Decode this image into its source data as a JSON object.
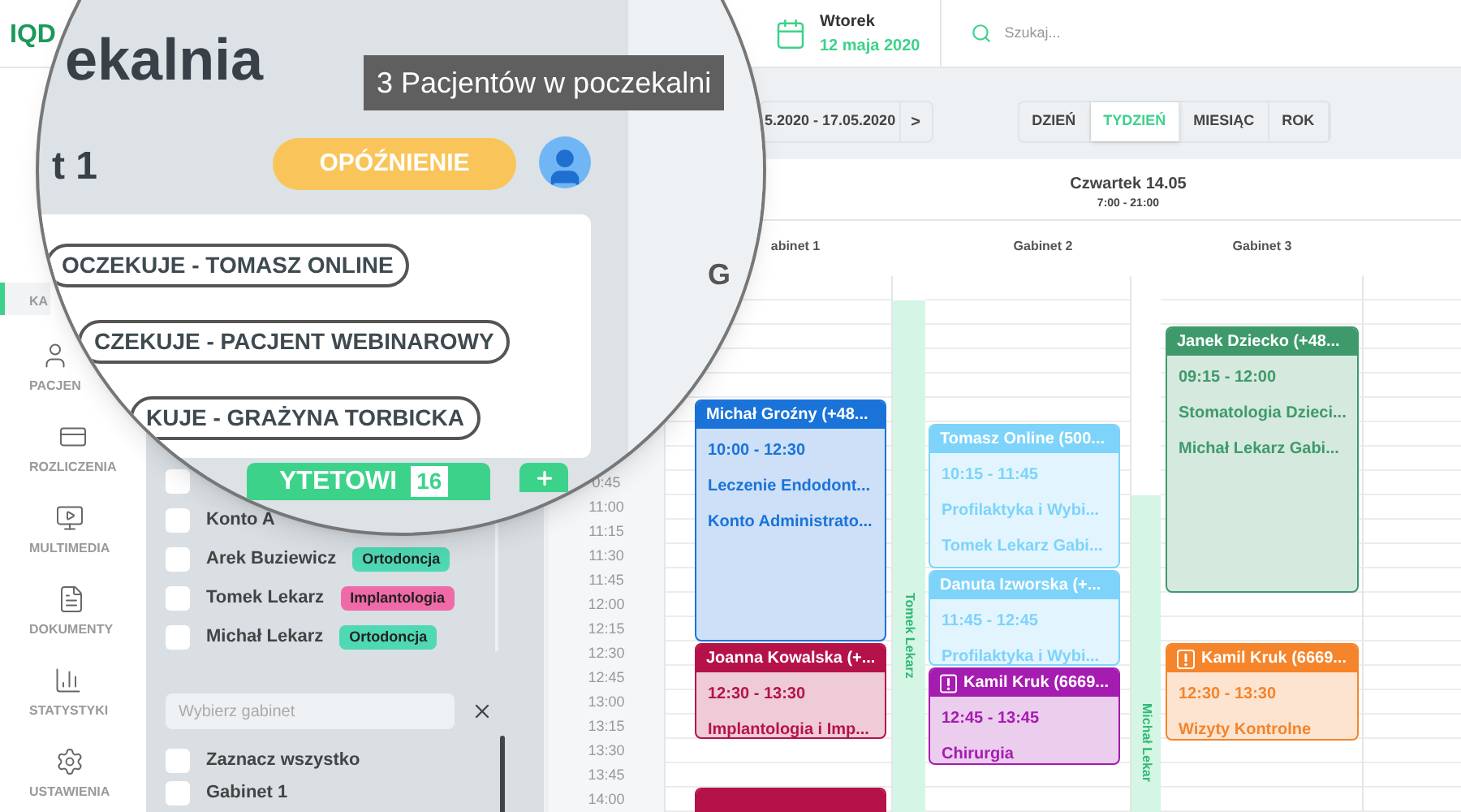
{
  "logo": "IQD",
  "sidebar": {
    "items": [
      {
        "label": "KA",
        "selected": true
      },
      {
        "label": "PACJEN",
        "selected": false
      },
      {
        "label": "ROZLICZENIA",
        "selected": false
      },
      {
        "label": "MULTIMEDIA",
        "selected": false
      },
      {
        "label": "DOKUMENTY",
        "selected": false
      },
      {
        "label": "STATYSTYKI",
        "selected": false
      },
      {
        "label": "USTAWIENIA",
        "selected": false
      }
    ]
  },
  "magnifier": {
    "title": "ekalnia",
    "tooltip": "3 Pacjentów w poczekalni",
    "subtitle": "t 1",
    "delay_button": "OPÓŹNIENIE",
    "waiting": [
      "OCZEKUJE - TOMASZ ONLINE",
      "CZEKUJE - PACJENT WEBINAROWY",
      "KUJE - GRAŻYNA TORBICKA"
    ],
    "green_button": {
      "label": "YTETOWI",
      "count": "16"
    },
    "column_heading": "G"
  },
  "doctors": [
    {
      "checked": false
    },
    {
      "name": "Konto A",
      "checked": false
    },
    {
      "name": "Arek Buziewicz",
      "checked": false,
      "tag": {
        "label": "Ortodoncja",
        "color": "#4fd8b4"
      }
    },
    {
      "name": "Tomek Lekarz",
      "checked": false,
      "tag": {
        "label": "Implantologia",
        "color": "#f06aa8"
      }
    },
    {
      "name": "Michał Lekarz",
      "checked": false,
      "tag": {
        "label": "Ortodoncja",
        "color": "#4fd8b4"
      }
    }
  ],
  "room_filter": {
    "placeholder": "Wybierz gabinet"
  },
  "rooms": [
    {
      "label": "Zaznacz wszystko",
      "checked": false
    },
    {
      "label": "Gabinet 1",
      "checked": false
    }
  ],
  "topbar": {
    "day": "Wtorek",
    "date": "12 maja 2020",
    "search_placeholder": "Szukaj..."
  },
  "date_range": {
    "label": "5.2020 - 17.05.2020",
    "next": ">"
  },
  "view_tabs": [
    {
      "label": "DZIEŃ",
      "selected": false
    },
    {
      "label": "TYDZIEŃ",
      "selected": true
    },
    {
      "label": "MIESIĄC",
      "selected": false
    },
    {
      "label": "ROK",
      "selected": false
    }
  ],
  "calendar": {
    "day": "Czwartek 14.05",
    "hours": "7:00 - 21:00",
    "times": [
      "0:45",
      "11:00",
      "11:15",
      "11:30",
      "11:45",
      "12:00",
      "12:15",
      "12:30",
      "12:45",
      "13:00",
      "13:15",
      "13:30",
      "13:45",
      "14:00"
    ],
    "staff": [
      "Tomek Lekarz",
      "Michał Lekar"
    ],
    "columns": [
      {
        "header": "abinet 1",
        "events": [
          {
            "title": "Michał Groźny (+48...",
            "lines": [
              "10:00 - 12:30",
              "Leczenie Endodont...",
              "Konto Administrato..."
            ],
            "color": "#1a73d9",
            "warning": false
          },
          {
            "title": "Joanna Kowalska (+...",
            "lines": [
              "12:30 - 13:30",
              "Implantologia i Imp..."
            ],
            "color": "#b5124a",
            "warning": false
          },
          {
            "color": "#b5124a",
            "warning": false
          }
        ]
      },
      {
        "header": "Gabinet 2",
        "events": [
          {
            "title": "Tomasz Online (500...",
            "lines": [
              "10:15 - 11:45",
              "Profilaktyka i Wybi...",
              "Tomek Lekarz Gabi..."
            ],
            "color": "#7dd3fa",
            "warning": false
          },
          {
            "title": "Danuta Izworska (+...",
            "lines": [
              "11:45 - 12:45",
              "Profilaktyka i Wybi..."
            ],
            "color": "#7dd3fa",
            "warning": false
          },
          {
            "title": "Kamil Kruk (6669...",
            "lines": [
              "12:45 - 13:45",
              "Chirurgia"
            ],
            "color": "#a51cb0",
            "warning": true
          }
        ]
      },
      {
        "header": "Gabinet 3",
        "events": [
          {
            "title": "Janek Dziecko (+48...",
            "lines": [
              "09:15 - 12:00",
              "Stomatologia Dzieci...",
              "Michał Lekarz Gabi..."
            ],
            "color": "#3e9a6b",
            "warning": false
          },
          {
            "title": "Kamil Kruk (6669...",
            "lines": [
              "12:30 - 13:30",
              "Wizyty Kontrolne"
            ],
            "color": "#f5842a",
            "warning": true
          }
        ]
      }
    ]
  }
}
